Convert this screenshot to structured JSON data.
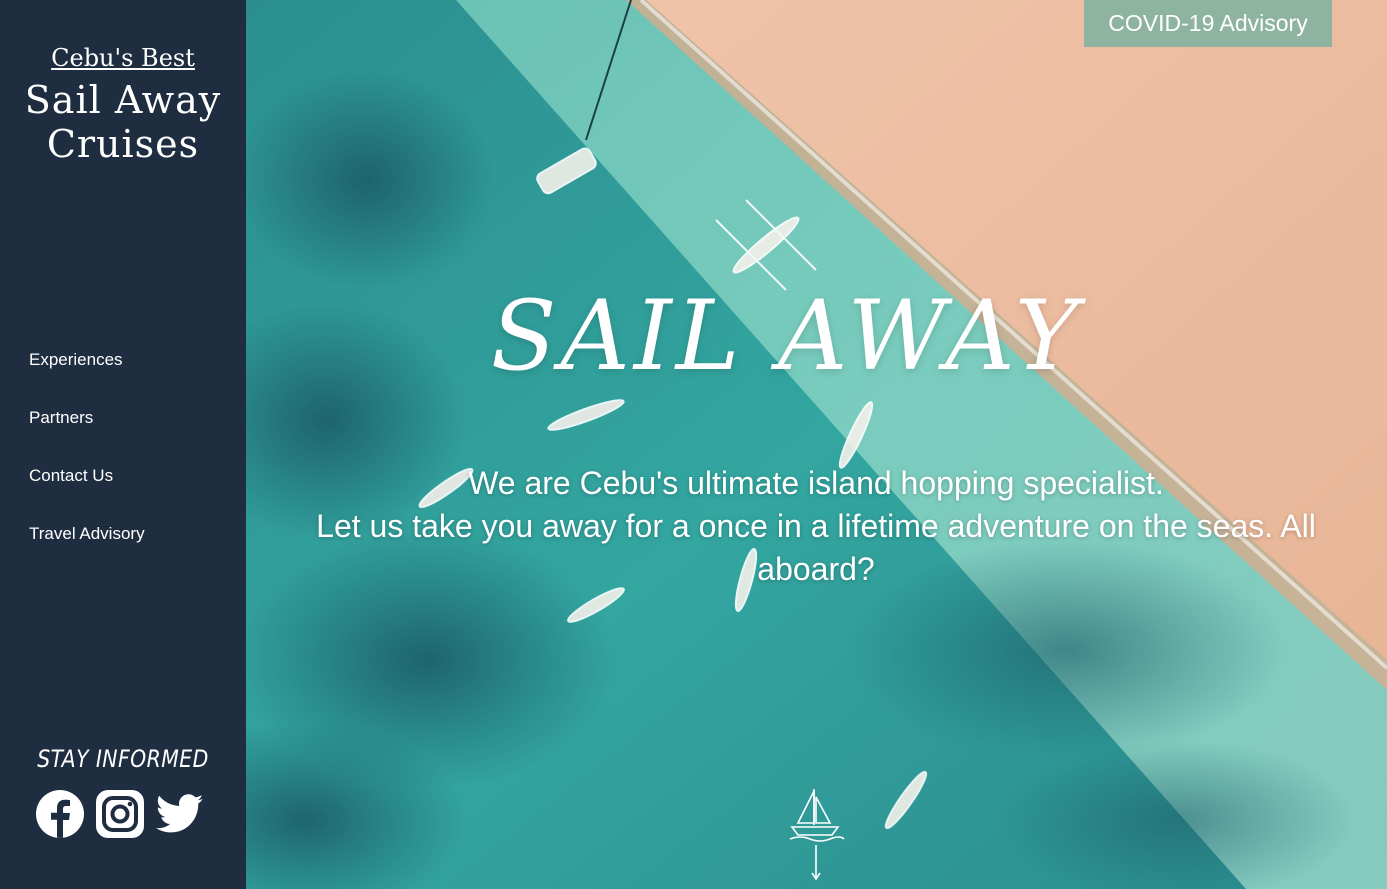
{
  "sidebar": {
    "brand_tag": "Cebu's Best",
    "brand_name_line1": "Sail Away",
    "brand_name_line2": "Cruises",
    "nav": [
      {
        "label": "Experiences"
      },
      {
        "label": "Partners"
      },
      {
        "label": "Contact Us"
      },
      {
        "label": "Travel Advisory"
      }
    ],
    "stay_informed": "STAY INFORMED",
    "social_icons": [
      "facebook-icon",
      "instagram-icon",
      "twitter-icon"
    ]
  },
  "hero": {
    "advisory_label": "COVID-19 Advisory",
    "headline": "SAIL AWAY",
    "tagline_line1": "We are Cebu's ultimate island hopping specialist.",
    "tagline_line2": "Let us take you away for a once in a lifetime adventure on the seas. All aboard?",
    "scroll_icon": "sailboat-icon"
  },
  "colors": {
    "sidebar_bg": "#1f2d40",
    "advisory_bg": "#8fb3a1",
    "sea": "#2a9b98",
    "sand": "#e6b59a"
  }
}
